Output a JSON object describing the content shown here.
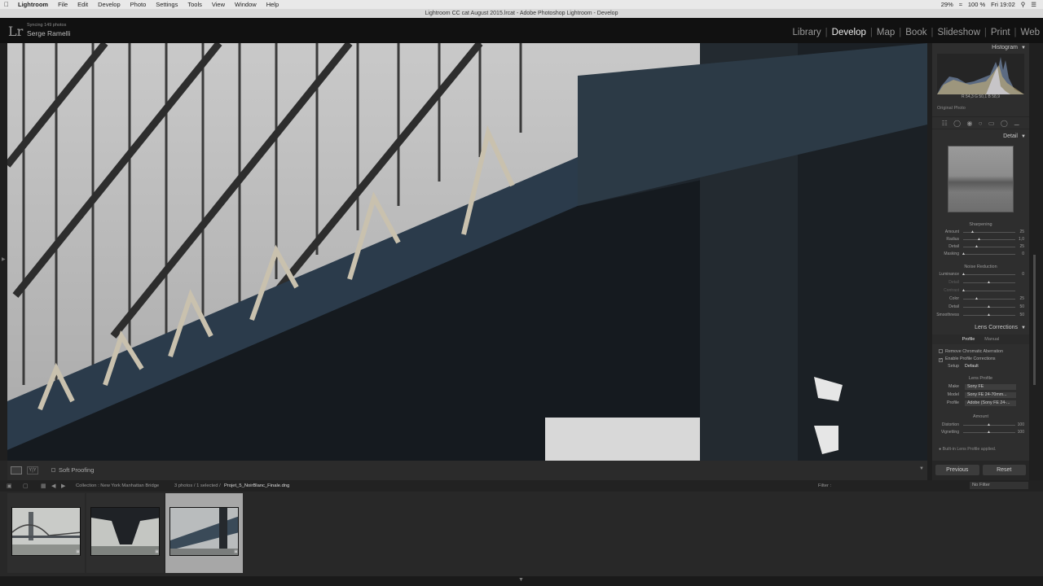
{
  "menubar": {
    "apple": "",
    "items": [
      "Lightroom",
      "File",
      "Edit",
      "Develop",
      "Photo",
      "Settings",
      "Tools",
      "View",
      "Window",
      "Help"
    ],
    "battery": "29%",
    "battery2": "100 %",
    "clock": "Fri 19:02"
  },
  "window": {
    "title": "Lightroom CC cat August 2015.lrcat - Adobe Photoshop Lightroom - Develop"
  },
  "identity": {
    "logo": "Lr",
    "subtitle": "Syncing 149 photos",
    "name": "Serge Ramelli"
  },
  "modules": [
    "Library",
    "Develop",
    "Map",
    "Book",
    "Slideshow",
    "Print",
    "Web"
  ],
  "active_module": "Develop",
  "right_panel": {
    "histogram_title": "Histogram",
    "histogram_values": "R  54,3   G  50,1   B  58,9",
    "original_photo": "Original Photo",
    "detail_title": "Detail",
    "sharpening_title": "Sharpening",
    "sharpening": [
      {
        "label": "Amount",
        "value": "25",
        "level": 0.17
      },
      {
        "label": "Radius",
        "value": "1,0",
        "level": 0.3
      },
      {
        "label": "Detail",
        "value": "25",
        "level": 0.25
      },
      {
        "label": "Masking",
        "value": "0",
        "level": 0.0
      }
    ],
    "noise_title": "Noise Reduction",
    "noise": [
      {
        "label": "Luminance",
        "value": "0",
        "level": 0.0,
        "dim": false
      },
      {
        "label": "Detail",
        "value": "",
        "level": 0.5,
        "dim": true
      },
      {
        "label": "Contrast",
        "value": "",
        "level": 0.0,
        "dim": true
      },
      {
        "label": "Color",
        "value": "25",
        "level": 0.25,
        "dim": false
      },
      {
        "label": "Detail",
        "value": "50",
        "level": 0.5,
        "dim": false
      },
      {
        "label": "Smoothness",
        "value": "50",
        "level": 0.5,
        "dim": false
      }
    ],
    "lens_title": "Lens Corrections",
    "lens_tabs": [
      "Profile",
      "Manual"
    ],
    "remove_ca": "Remove Chromatic Aberration",
    "enable_profile": "Enable Profile Corrections",
    "setup_label": "Setup",
    "setup_value": "Default",
    "lens_profile_title": "Lens Profile",
    "make_label": "Make",
    "make_value": "Sony FE",
    "model_label": "Model",
    "model_value": "Sony FE 24-70mm...",
    "profile_label": "Profile",
    "profile_value": "Adobe (Sony FE 24-...",
    "amount_title": "Amount",
    "amount": [
      {
        "label": "Distortion",
        "value": "100",
        "level": 0.5
      },
      {
        "label": "Vignetting",
        "value": "100",
        "level": 0.5
      }
    ],
    "builtin_note": "Built-in Lens Profile applied."
  },
  "toolbar": {
    "soft_proofing": "Soft Proofing",
    "yy": "Y|Y"
  },
  "buttons": {
    "previous": "Previous",
    "reset": "Reset"
  },
  "filmstrip_bar": {
    "collection": "Collection : New York Manhattan Bridge",
    "count": "3 photos / 1 selected /",
    "filename": "Projet_5_NoirBlanc_Finale.dng",
    "filter_label": "Filter :",
    "filter_value": "No Filter"
  },
  "colors": {
    "bg": "#262626",
    "panel": "#2e2e2e",
    "selected_cell": "#a7a7a7",
    "bridge_blue": "#3b5a78"
  }
}
